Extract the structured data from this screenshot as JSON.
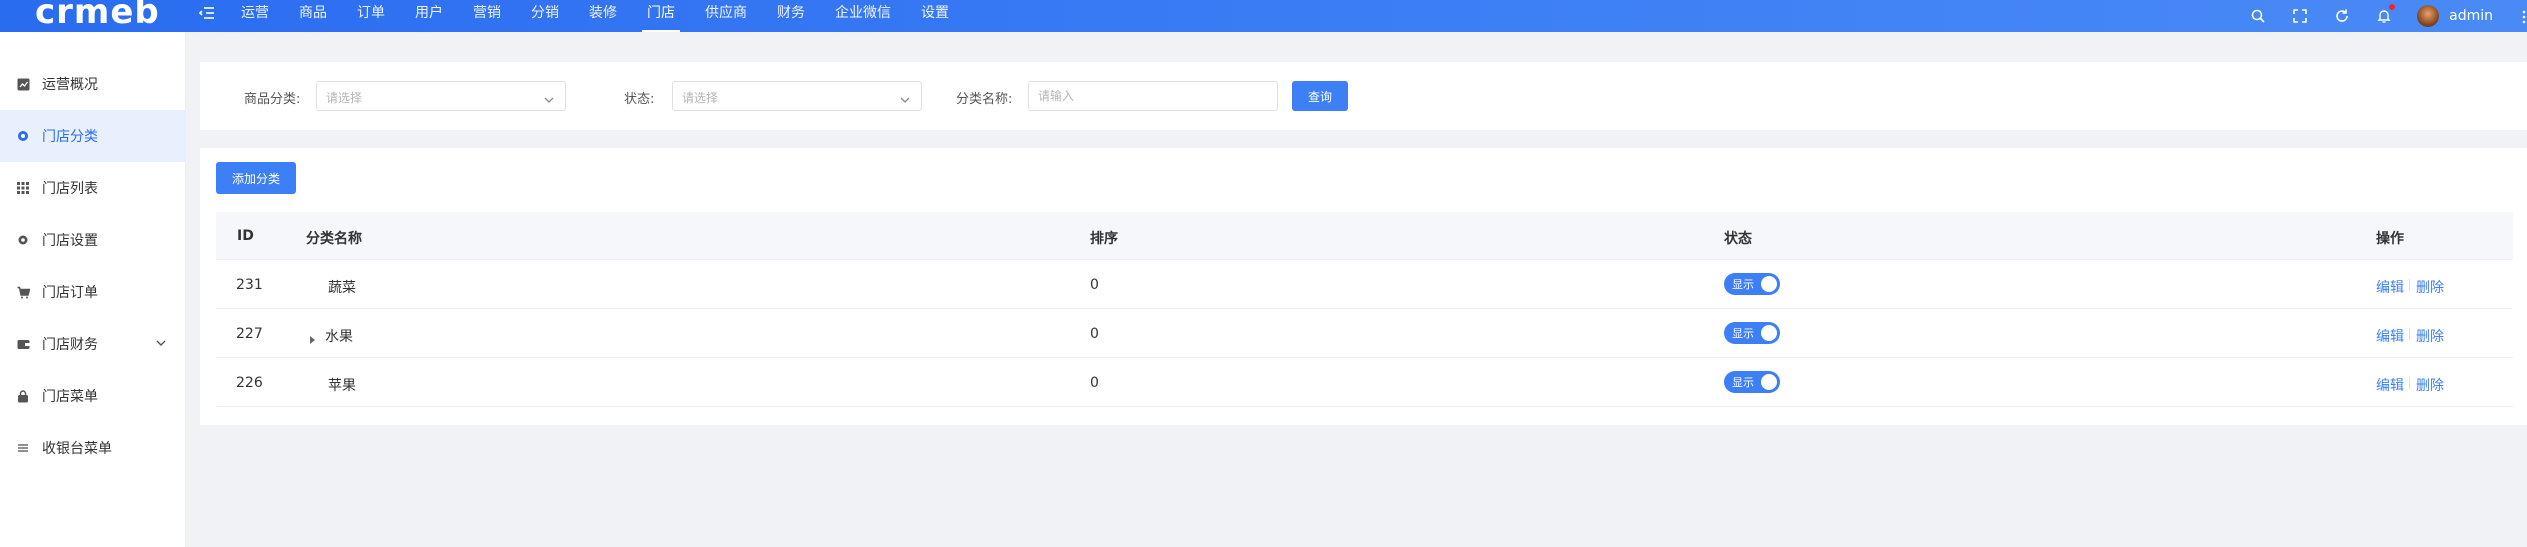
{
  "brand": {
    "logo_text": "crmeb"
  },
  "topnav": [
    "运营",
    "商品",
    "订单",
    "用户",
    "营销",
    "分销",
    "装修",
    "门店",
    "供应商",
    "财务",
    "企业微信",
    "设置"
  ],
  "topnav_active": "门店",
  "header_right": {
    "user_name": "admin"
  },
  "sidebar": {
    "items": [
      {
        "label": "运营概况",
        "icon": "chart-icon"
      },
      {
        "label": "门店分类",
        "icon": "circle-icon",
        "active": true
      },
      {
        "label": "门店列表",
        "icon": "grid-icon"
      },
      {
        "label": "门店设置",
        "icon": "gear-icon"
      },
      {
        "label": "门店订单",
        "icon": "cart-icon"
      },
      {
        "label": "门店财务",
        "icon": "wallet-icon",
        "has_submenu": true
      },
      {
        "label": "门店菜单",
        "icon": "lock-icon"
      },
      {
        "label": "收银台菜单",
        "icon": "menu-icon"
      }
    ]
  },
  "search": {
    "category_label": "商品分类:",
    "category_placeholder": "请选择",
    "status_label": "状态:",
    "status_placeholder": "请选择",
    "name_label": "分类名称:",
    "name_placeholder": "请输入",
    "query_button": "查询"
  },
  "toolbar": {
    "add_button": "添加分类"
  },
  "table": {
    "headers": {
      "id": "ID",
      "name": "分类名称",
      "sort": "排序",
      "status": "状态",
      "actions": "操作"
    },
    "rows": [
      {
        "id": "231",
        "name": "蔬菜",
        "sort": "0",
        "status": "显示",
        "expandable": false
      },
      {
        "id": "227",
        "name": "水果",
        "sort": "0",
        "status": "显示",
        "expandable": true
      },
      {
        "id": "226",
        "name": "苹果",
        "sort": "0",
        "status": "显示",
        "expandable": false
      }
    ],
    "edit_label": "编辑",
    "delete_label": "删除"
  },
  "colors": {
    "primary": "#3d7ff5",
    "header_gradient_start": "#2a6cf0",
    "sidebar_active_bg": "#e8f0fe"
  }
}
